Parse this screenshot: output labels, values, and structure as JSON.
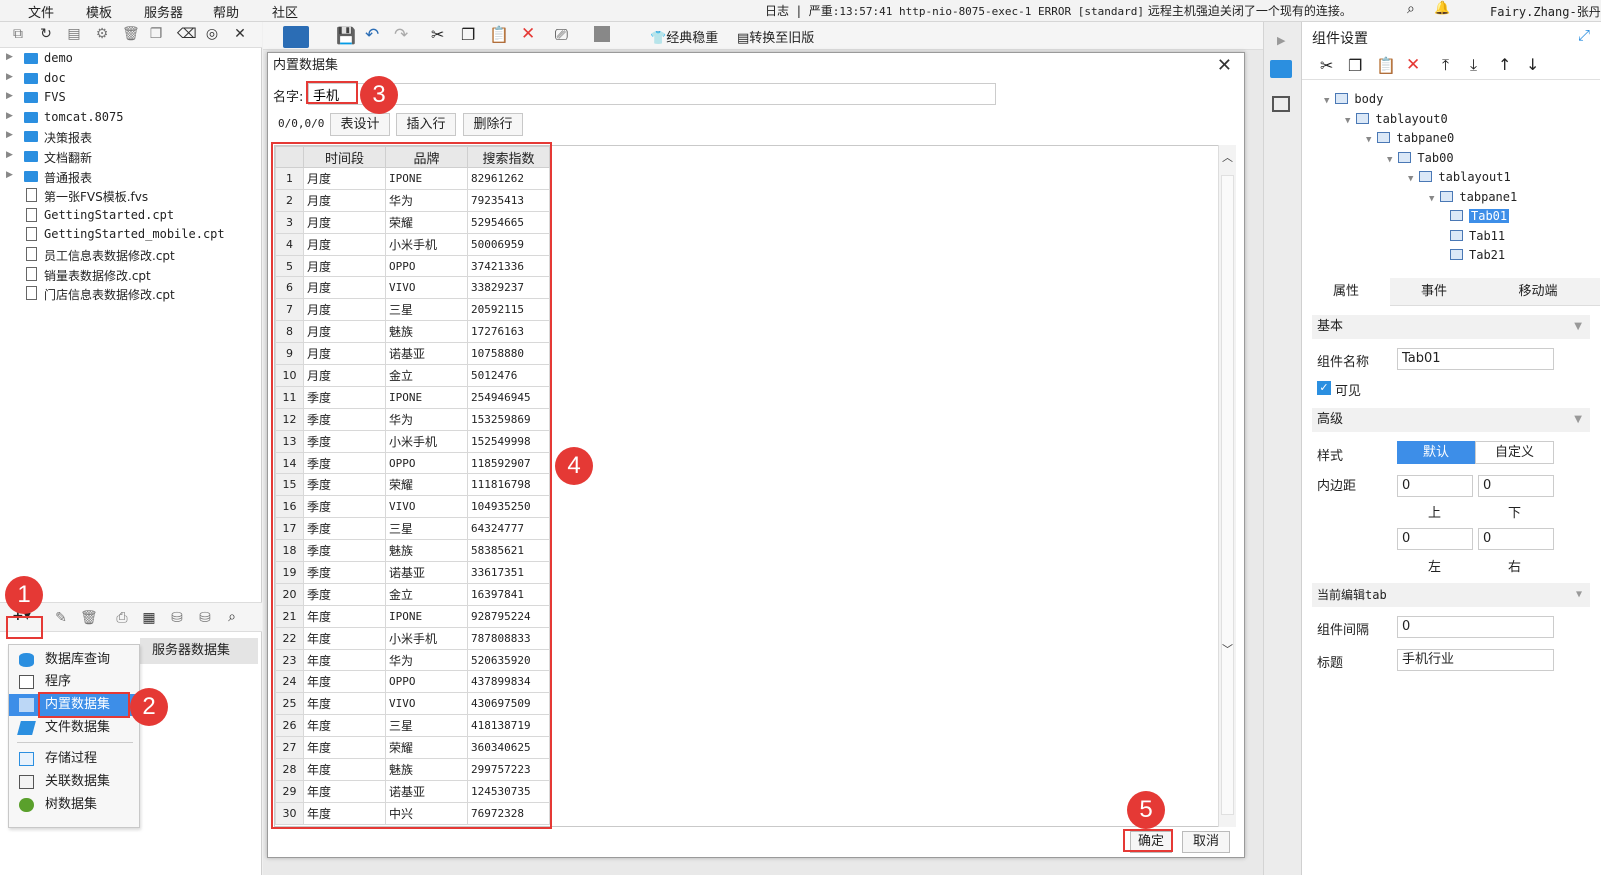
{
  "menubar": {
    "items": [
      "文件",
      "模板",
      "服务器",
      "帮助",
      "社区"
    ],
    "log_label": "日志",
    "log_level": "严重",
    "log_message": ":13:57:41 http-nio-8075-exec-1 ERROR [standard]",
    "log_text": "远程主机强迫关闭了一个现有的连接。",
    "user": "Fairy.Zhang-张丹"
  },
  "file_tree": [
    {
      "type": "folder",
      "label": "demo"
    },
    {
      "type": "folder",
      "label": "doc"
    },
    {
      "type": "folder",
      "label": "FVS"
    },
    {
      "type": "folder",
      "label": "tomcat.8075"
    },
    {
      "type": "folder",
      "label": "决策报表"
    },
    {
      "type": "folder",
      "label": "文档翻新"
    },
    {
      "type": "folder",
      "label": "普通报表"
    },
    {
      "type": "file",
      "label": "第一张FVS模板.fvs"
    },
    {
      "type": "file",
      "label": "GettingStarted.cpt"
    },
    {
      "type": "file",
      "label": "GettingStarted_mobile.cpt"
    },
    {
      "type": "file",
      "label": "员工信息表数据修改.cpt"
    },
    {
      "type": "file",
      "label": "销量表数据修改.cpt"
    },
    {
      "type": "file",
      "label": "门店信息表数据修改.cpt"
    }
  ],
  "dataset_panel": {
    "add_button": "+▾",
    "server_tab": "服务器数据集",
    "menu": [
      "数据库查询",
      "程序",
      "内置数据集",
      "文件数据集",
      "存储过程",
      "关联数据集",
      "树数据集"
    ]
  },
  "toolbar": {
    "classic": "经典稳重",
    "convert": "转换至旧版"
  },
  "dialog": {
    "title": "内置数据集",
    "name_label": "名字:",
    "name_value": "手机",
    "position": "0/0,0/0",
    "table_design": "表设计",
    "insert_row": "插入行",
    "delete_row": "删除行",
    "columns": [
      "时间段",
      "品牌",
      "搜索指数"
    ],
    "rows": [
      [
        "月度",
        "IPONE",
        "82961262"
      ],
      [
        "月度",
        "华为",
        "79235413"
      ],
      [
        "月度",
        "荣耀",
        "52954665"
      ],
      [
        "月度",
        "小米手机",
        "50006959"
      ],
      [
        "月度",
        "OPPO",
        "37421336"
      ],
      [
        "月度",
        "VIVO",
        "33829237"
      ],
      [
        "月度",
        "三星",
        "20592115"
      ],
      [
        "月度",
        "魅族",
        "17276163"
      ],
      [
        "月度",
        "诺基亚",
        "10758880"
      ],
      [
        "月度",
        "金立",
        "5012476"
      ],
      [
        "季度",
        "IPONE",
        "254946945"
      ],
      [
        "季度",
        "华为",
        "153259869"
      ],
      [
        "季度",
        "小米手机",
        "152549998"
      ],
      [
        "季度",
        "OPPO",
        "118592907"
      ],
      [
        "季度",
        "荣耀",
        "111816798"
      ],
      [
        "季度",
        "VIVO",
        "104935250"
      ],
      [
        "季度",
        "三星",
        "64324777"
      ],
      [
        "季度",
        "魅族",
        "58385621"
      ],
      [
        "季度",
        "诺基亚",
        "33617351"
      ],
      [
        "季度",
        "金立",
        "16397841"
      ],
      [
        "年度",
        "IPONE",
        "928795224"
      ],
      [
        "年度",
        "小米手机",
        "787808833"
      ],
      [
        "年度",
        "华为",
        "520635920"
      ],
      [
        "年度",
        "OPPO",
        "437899834"
      ],
      [
        "年度",
        "VIVO",
        "430697509"
      ],
      [
        "年度",
        "三星",
        "418138719"
      ],
      [
        "年度",
        "荣耀",
        "360340625"
      ],
      [
        "年度",
        "魅族",
        "299757223"
      ],
      [
        "年度",
        "诺基亚",
        "124530735"
      ],
      [
        "年度",
        "中兴",
        "76972328"
      ]
    ],
    "ok": "确定",
    "cancel": "取消"
  },
  "right_panel": {
    "title": "组件设置",
    "tree": [
      {
        "label": "body",
        "level": 0
      },
      {
        "label": "tablayout0",
        "level": 1
      },
      {
        "label": "tabpane0",
        "level": 2
      },
      {
        "label": "Tab00",
        "level": 3
      },
      {
        "label": "tablayout1",
        "level": 4
      },
      {
        "label": "tabpane1",
        "level": 5
      },
      {
        "label": "Tab01",
        "level": 6,
        "selected": true
      },
      {
        "label": "Tab11",
        "level": 6
      },
      {
        "label": "Tab21",
        "level": 6
      }
    ],
    "tabs": [
      "属性",
      "事件",
      "移动端"
    ],
    "basic": "基本",
    "widget_name_label": "组件名称",
    "widget_name": "Tab01",
    "visible": "可见",
    "advanced": "高级",
    "style_label": "样式",
    "style_default": "默认",
    "style_custom": "自定义",
    "padding_label": "内边距",
    "padding": {
      "top": "0",
      "bottom": "0",
      "left": "0",
      "right": "0"
    },
    "padding_names": {
      "top": "上",
      "bottom": "下",
      "left": "左",
      "right": "右"
    },
    "current_tab": "当前编辑tab",
    "spacing_label": "组件间隔",
    "spacing": "0",
    "title_label": "标题",
    "title_value": "手机行业"
  },
  "annotations": [
    "1",
    "2",
    "3",
    "4",
    "5"
  ],
  "colors": {
    "highlight": "#e53935",
    "accent": "#2b8fe0",
    "selected": "#3d8ee8"
  }
}
